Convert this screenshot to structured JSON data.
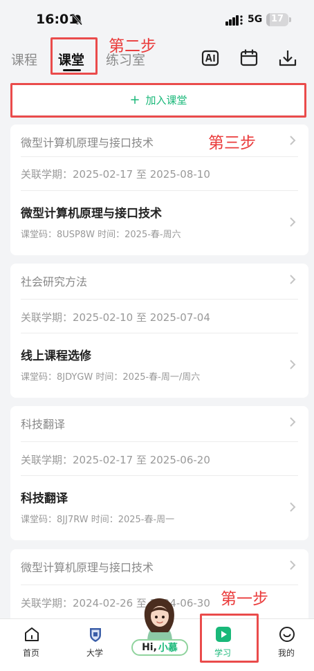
{
  "status_bar": {
    "time": "16:01",
    "network": "5G",
    "battery": "17",
    "battery_level": 0.17
  },
  "tabs": [
    {
      "label": "课程",
      "active": false
    },
    {
      "label": "课堂",
      "active": true
    },
    {
      "label": "练习室",
      "active": false
    }
  ],
  "header_icons": [
    "ai-icon",
    "calendar-icon",
    "download-icon"
  ],
  "annotations": {
    "step1": "第一步",
    "step2": "第二步",
    "step3": "第三步",
    "color": "#ea3b3b"
  },
  "join_button": {
    "icon": "+",
    "label": "加入课堂"
  },
  "courses": [
    {
      "course_name": "微型计算机原理与接口技术",
      "term": "关联学期：2025-02-17 至 2025-08-10",
      "class_name": "微型计算机原理与接口技术",
      "meta": "课堂码：8USP8W  时间：2025-春-周六"
    },
    {
      "course_name": "社会研究方法",
      "term": "关联学期：2025-02-10 至 2025-07-04",
      "class_name": "线上课程选修",
      "meta": "课堂码：8JDYGW  时间：2025-春-周一/周六"
    },
    {
      "course_name": "科技翻译",
      "term": "关联学期：2025-02-17 至 2025-06-20",
      "class_name": "科技翻译",
      "meta": "课堂码：8JJ7RW  时间：2025-春-周一"
    },
    {
      "course_name": "微型计算机原理与接口技术",
      "term": "关联学期：2024-02-26 至 2024-06-30"
    }
  ],
  "bottom_nav": [
    {
      "label": "首页",
      "icon": "home-icon"
    },
    {
      "label": "大学",
      "icon": "university-icon"
    },
    {
      "label": "学习",
      "icon": "play-icon",
      "active": true
    },
    {
      "label": "我的",
      "icon": "smile-icon"
    }
  ],
  "mascot": {
    "hi": "Hi,",
    "name": "小慕"
  },
  "colors": {
    "accent": "#19b879",
    "background": "#f3f4f6",
    "annotation_red": "#ea4b4b"
  }
}
